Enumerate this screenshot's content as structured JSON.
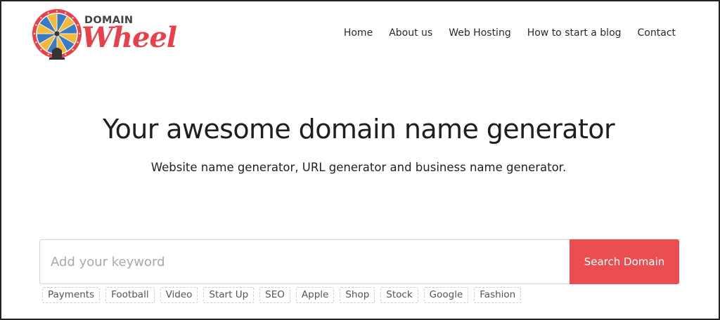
{
  "logo": {
    "word_top": "DOMAIN",
    "word_main": "Wheel",
    "colors": {
      "red": "#e8414b",
      "blue": "#3a7bc4",
      "yellow": "#f3b93a",
      "dark": "#333333"
    }
  },
  "nav": {
    "items": [
      {
        "label": "Home"
      },
      {
        "label": "About us"
      },
      {
        "label": "Web Hosting"
      },
      {
        "label": "How to start a blog"
      },
      {
        "label": "Contact"
      }
    ]
  },
  "hero": {
    "title": "Your awesome domain name generator",
    "subtitle": "Website name generator, URL generator and business name generator."
  },
  "search": {
    "placeholder": "Add your keyword",
    "value": "",
    "button_label": "Search Domain",
    "button_color": "#ea4e51"
  },
  "tags": [
    "Payments",
    "Football",
    "Video",
    "Start Up",
    "SEO",
    "Apple",
    "Shop",
    "Stock",
    "Google",
    "Fashion"
  ]
}
